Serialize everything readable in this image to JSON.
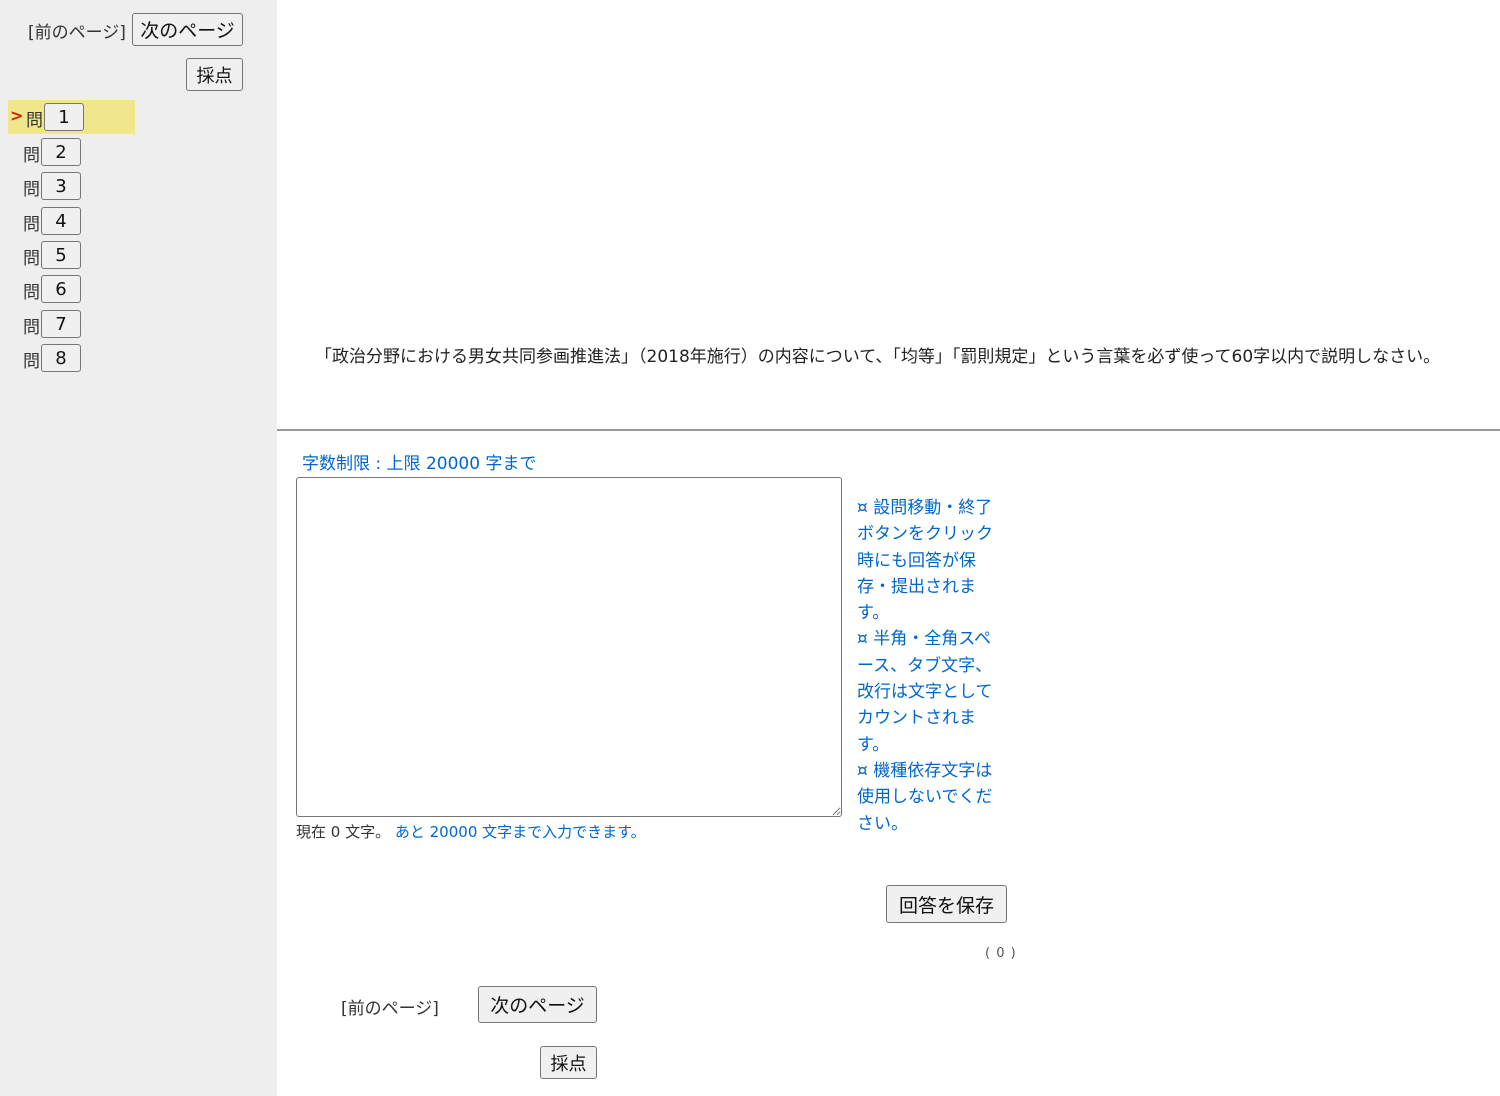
{
  "nav": {
    "prev_label": "[前のページ]",
    "next_label": "次のページ",
    "grade_label": "採点"
  },
  "questions": {
    "marker": ">",
    "prefix": "問",
    "current_index": 0,
    "items": [
      "1",
      "2",
      "3",
      "4",
      "5",
      "6",
      "7",
      "8"
    ]
  },
  "question_text": "「政治分野における男女共同参画推進法」（2018年施行）の内容について、「均等」「罰則規定」という言葉を必ず使って60字以内で説明しなさい。",
  "answer": {
    "char_limit": "字数制限 : 上限 20000 字まで",
    "value": "",
    "count_current": "現在 0 文字。",
    "count_remaining": "あと 20000 文字まで入力できます。",
    "notes": [
      "¤ 設問移動・終了ボタンをクリック時にも回答が保存・提出されます。",
      "¤ 半角・全角スペース、タブ文字、改行は文字としてカウントされます。",
      "¤ 機種依存文字は使用しないでください。"
    ],
    "save_label": "回答を保存",
    "save_count": "( 0 )"
  },
  "colors": {
    "sidebar_bg": "#eeeeee",
    "current_highlight": "#f0e68c",
    "link_blue": "#0066cc",
    "marker_red": "#cc2200"
  }
}
